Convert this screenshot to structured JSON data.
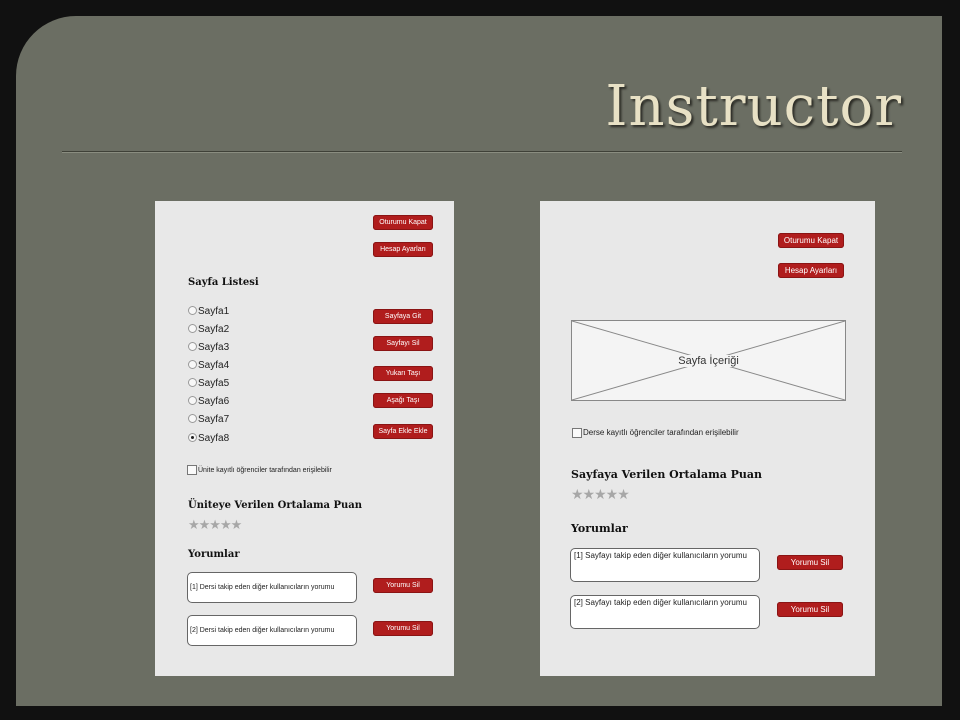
{
  "slide": {
    "title": "Instructor"
  },
  "left_mockup": {
    "logout_label": "Oturumu Kapat",
    "account_label": "Hesap Ayarları",
    "page_list_heading": "Sayfa Listesi",
    "pages": [
      "Sayfa1",
      "Sayfa2",
      "Sayfa3",
      "Sayfa4",
      "Sayfa5",
      "Sayfa6",
      "Sayfa7",
      "Sayfa8"
    ],
    "selected_page": "Sayfa8",
    "actions": {
      "go_label": "Sayfaya Git",
      "delete_label": "Sayfayı Sil",
      "up_label": "Yukarı Taşı",
      "down_label": "Aşağı Taşı",
      "add_label": "Sayfa Ekle Ekle"
    },
    "access_checkbox_label": "Ünite kayıtlı öğrenciler tarafından erişilebilir",
    "access_checked": false,
    "rating_heading": "Üniteye Verilen Ortalama Puan",
    "rating_stars": "★★★★★",
    "comments_heading": "Yorumlar",
    "comments": [
      "[1] Dersi takip eden diğer kullanıcıların yorumu",
      "[2] Dersi takip eden diğer kullanıcıların yorumu"
    ],
    "delete_comment_label": "Yorumu Sil"
  },
  "right_mockup": {
    "logout_label": "Oturumu Kapat",
    "account_label": "Hesap Ayarları",
    "content_placeholder": "Sayfa İçeriği",
    "access_checkbox_label": "Derse kayıtlı öğrenciler tarafından erişilebilir",
    "access_checked": false,
    "rating_heading": "Sayfaya Verilen Ortalama Puan",
    "rating_stars": "★★★★★",
    "comments_heading": "Yorumlar",
    "comments": [
      "[1] Sayfayı takip eden diğer kullanıcıların yorumu",
      "[2] Sayfayı takip eden diğer kullanıcıların yorumu"
    ],
    "delete_comment_label": "Yorumu Sil"
  },
  "colors": {
    "slide_background": "#6b6e63",
    "title_text": "#e8e1c5",
    "button_red": "#b01d1d",
    "mockup_background": "#e8e8e8"
  }
}
